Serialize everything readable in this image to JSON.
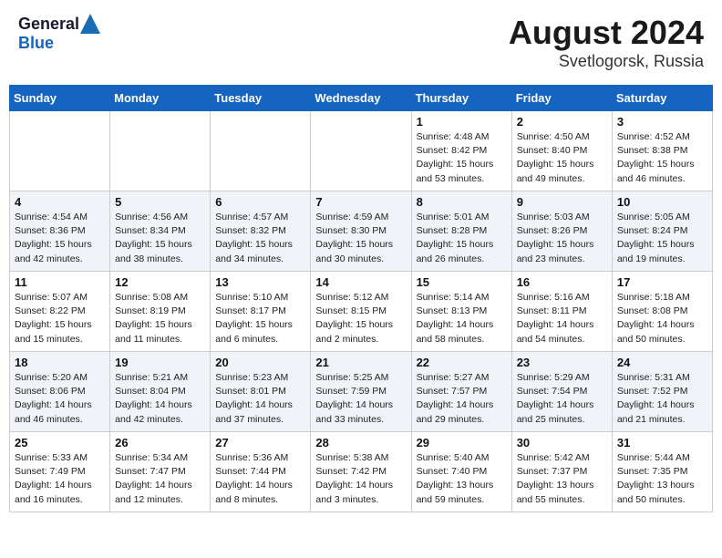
{
  "logo": {
    "general": "General",
    "blue": "Blue"
  },
  "title": {
    "month": "August 2024",
    "location": "Svetlogorsk, Russia"
  },
  "headers": [
    "Sunday",
    "Monday",
    "Tuesday",
    "Wednesday",
    "Thursday",
    "Friday",
    "Saturday"
  ],
  "weeks": [
    [
      {
        "day": "",
        "sunrise": "",
        "sunset": "",
        "daylight": ""
      },
      {
        "day": "",
        "sunrise": "",
        "sunset": "",
        "daylight": ""
      },
      {
        "day": "",
        "sunrise": "",
        "sunset": "",
        "daylight": ""
      },
      {
        "day": "",
        "sunrise": "",
        "sunset": "",
        "daylight": ""
      },
      {
        "day": "1",
        "sunrise": "Sunrise: 4:48 AM",
        "sunset": "Sunset: 8:42 PM",
        "daylight": "Daylight: 15 hours and 53 minutes."
      },
      {
        "day": "2",
        "sunrise": "Sunrise: 4:50 AM",
        "sunset": "Sunset: 8:40 PM",
        "daylight": "Daylight: 15 hours and 49 minutes."
      },
      {
        "day": "3",
        "sunrise": "Sunrise: 4:52 AM",
        "sunset": "Sunset: 8:38 PM",
        "daylight": "Daylight: 15 hours and 46 minutes."
      }
    ],
    [
      {
        "day": "4",
        "sunrise": "Sunrise: 4:54 AM",
        "sunset": "Sunset: 8:36 PM",
        "daylight": "Daylight: 15 hours and 42 minutes."
      },
      {
        "day": "5",
        "sunrise": "Sunrise: 4:56 AM",
        "sunset": "Sunset: 8:34 PM",
        "daylight": "Daylight: 15 hours and 38 minutes."
      },
      {
        "day": "6",
        "sunrise": "Sunrise: 4:57 AM",
        "sunset": "Sunset: 8:32 PM",
        "daylight": "Daylight: 15 hours and 34 minutes."
      },
      {
        "day": "7",
        "sunrise": "Sunrise: 4:59 AM",
        "sunset": "Sunset: 8:30 PM",
        "daylight": "Daylight: 15 hours and 30 minutes."
      },
      {
        "day": "8",
        "sunrise": "Sunrise: 5:01 AM",
        "sunset": "Sunset: 8:28 PM",
        "daylight": "Daylight: 15 hours and 26 minutes."
      },
      {
        "day": "9",
        "sunrise": "Sunrise: 5:03 AM",
        "sunset": "Sunset: 8:26 PM",
        "daylight": "Daylight: 15 hours and 23 minutes."
      },
      {
        "day": "10",
        "sunrise": "Sunrise: 5:05 AM",
        "sunset": "Sunset: 8:24 PM",
        "daylight": "Daylight: 15 hours and 19 minutes."
      }
    ],
    [
      {
        "day": "11",
        "sunrise": "Sunrise: 5:07 AM",
        "sunset": "Sunset: 8:22 PM",
        "daylight": "Daylight: 15 hours and 15 minutes."
      },
      {
        "day": "12",
        "sunrise": "Sunrise: 5:08 AM",
        "sunset": "Sunset: 8:19 PM",
        "daylight": "Daylight: 15 hours and 11 minutes."
      },
      {
        "day": "13",
        "sunrise": "Sunrise: 5:10 AM",
        "sunset": "Sunset: 8:17 PM",
        "daylight": "Daylight: 15 hours and 6 minutes."
      },
      {
        "day": "14",
        "sunrise": "Sunrise: 5:12 AM",
        "sunset": "Sunset: 8:15 PM",
        "daylight": "Daylight: 15 hours and 2 minutes."
      },
      {
        "day": "15",
        "sunrise": "Sunrise: 5:14 AM",
        "sunset": "Sunset: 8:13 PM",
        "daylight": "Daylight: 14 hours and 58 minutes."
      },
      {
        "day": "16",
        "sunrise": "Sunrise: 5:16 AM",
        "sunset": "Sunset: 8:11 PM",
        "daylight": "Daylight: 14 hours and 54 minutes."
      },
      {
        "day": "17",
        "sunrise": "Sunrise: 5:18 AM",
        "sunset": "Sunset: 8:08 PM",
        "daylight": "Daylight: 14 hours and 50 minutes."
      }
    ],
    [
      {
        "day": "18",
        "sunrise": "Sunrise: 5:20 AM",
        "sunset": "Sunset: 8:06 PM",
        "daylight": "Daylight: 14 hours and 46 minutes."
      },
      {
        "day": "19",
        "sunrise": "Sunrise: 5:21 AM",
        "sunset": "Sunset: 8:04 PM",
        "daylight": "Daylight: 14 hours and 42 minutes."
      },
      {
        "day": "20",
        "sunrise": "Sunrise: 5:23 AM",
        "sunset": "Sunset: 8:01 PM",
        "daylight": "Daylight: 14 hours and 37 minutes."
      },
      {
        "day": "21",
        "sunrise": "Sunrise: 5:25 AM",
        "sunset": "Sunset: 7:59 PM",
        "daylight": "Daylight: 14 hours and 33 minutes."
      },
      {
        "day": "22",
        "sunrise": "Sunrise: 5:27 AM",
        "sunset": "Sunset: 7:57 PM",
        "daylight": "Daylight: 14 hours and 29 minutes."
      },
      {
        "day": "23",
        "sunrise": "Sunrise: 5:29 AM",
        "sunset": "Sunset: 7:54 PM",
        "daylight": "Daylight: 14 hours and 25 minutes."
      },
      {
        "day": "24",
        "sunrise": "Sunrise: 5:31 AM",
        "sunset": "Sunset: 7:52 PM",
        "daylight": "Daylight: 14 hours and 21 minutes."
      }
    ],
    [
      {
        "day": "25",
        "sunrise": "Sunrise: 5:33 AM",
        "sunset": "Sunset: 7:49 PM",
        "daylight": "Daylight: 14 hours and 16 minutes."
      },
      {
        "day": "26",
        "sunrise": "Sunrise: 5:34 AM",
        "sunset": "Sunset: 7:47 PM",
        "daylight": "Daylight: 14 hours and 12 minutes."
      },
      {
        "day": "27",
        "sunrise": "Sunrise: 5:36 AM",
        "sunset": "Sunset: 7:44 PM",
        "daylight": "Daylight: 14 hours and 8 minutes."
      },
      {
        "day": "28",
        "sunrise": "Sunrise: 5:38 AM",
        "sunset": "Sunset: 7:42 PM",
        "daylight": "Daylight: 14 hours and 3 minutes."
      },
      {
        "day": "29",
        "sunrise": "Sunrise: 5:40 AM",
        "sunset": "Sunset: 7:40 PM",
        "daylight": "Daylight: 13 hours and 59 minutes."
      },
      {
        "day": "30",
        "sunrise": "Sunrise: 5:42 AM",
        "sunset": "Sunset: 7:37 PM",
        "daylight": "Daylight: 13 hours and 55 minutes."
      },
      {
        "day": "31",
        "sunrise": "Sunrise: 5:44 AM",
        "sunset": "Sunset: 7:35 PM",
        "daylight": "Daylight: 13 hours and 50 minutes."
      }
    ]
  ]
}
